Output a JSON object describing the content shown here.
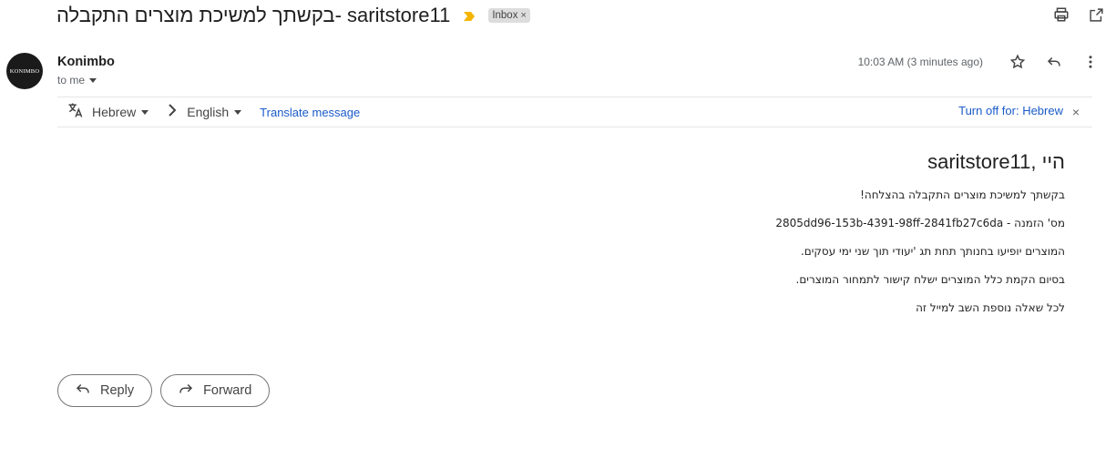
{
  "header": {
    "subject": "בקשתך למשיכת מוצרים התקבלה- saritstore11",
    "label_chip": "Inbox",
    "label_chip_remove": "×",
    "importance_color": "#f4b400",
    "print_icon": "print-icon",
    "open_new_window_icon": "open-in-new-window-icon"
  },
  "message": {
    "avatar_text": "KONIMBO",
    "sender": "Konimbo",
    "recipient": "to me",
    "timestamp": "10:03 AM (3 minutes ago)"
  },
  "translate": {
    "source_language": "Hebrew",
    "target_language": "English",
    "translate_link": "Translate message",
    "turn_off": "Turn off for: Hebrew",
    "close": "×",
    "link_color": "#1a5ac8"
  },
  "body": {
    "greeting": "היי ,saritstore11",
    "lines": [
      "בקשתך למשיכת מוצרים התקבלה בהצלחה!",
      "מס' הזמנה - 2805dd96-153b-4391-98ff-2841fb27c6da",
      "המוצרים יופיעו בחנותך תחת תג 'יעודי תוך שני ימי עסקים.",
      "בסיום הקמת כלל המוצרים ישלח קישור לתמחור המוצרים.",
      "לכל שאלה נוספת השב למייל זה"
    ]
  },
  "actions": {
    "reply": "Reply",
    "forward": "Forward"
  }
}
